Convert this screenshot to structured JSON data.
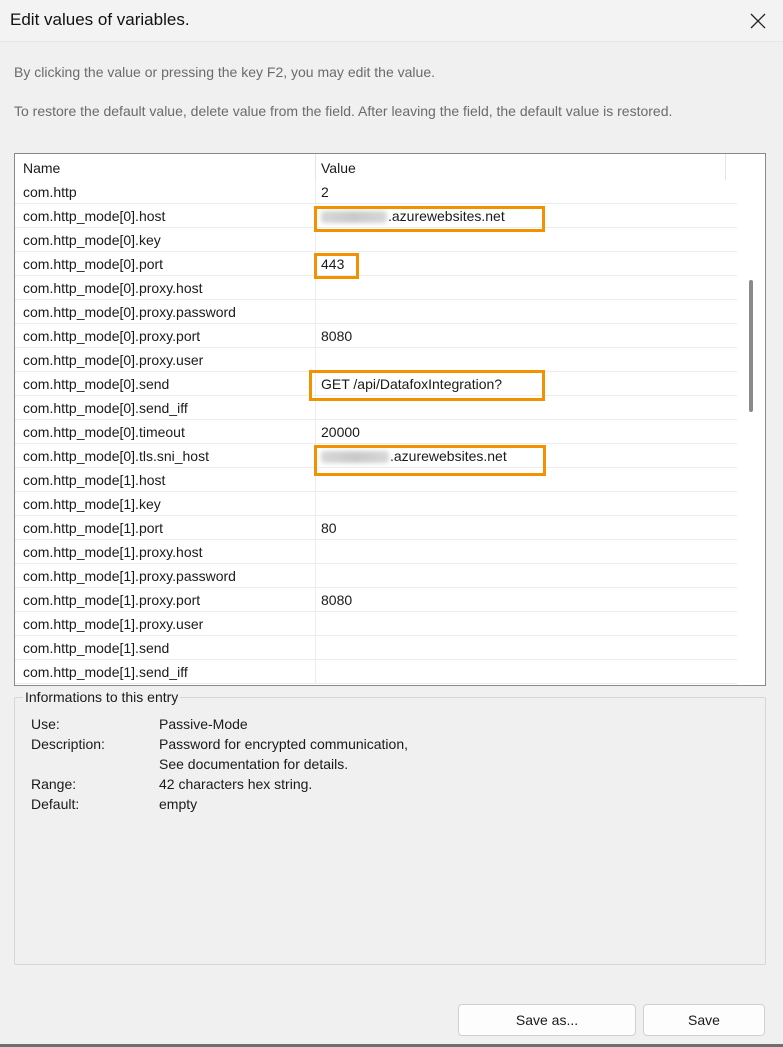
{
  "window": {
    "title": "Edit values of variables.",
    "close_icon": "close-icon"
  },
  "hints": {
    "line1": "By clicking the value or pressing the key F2, you may edit the value.",
    "line2": "To restore the default value, delete value from the field. After leaving the field, the default value is restored."
  },
  "grid": {
    "headers": {
      "name": "Name",
      "value": "Value"
    },
    "rows": [
      {
        "name": "com.http",
        "value": "2"
      },
      {
        "name": "com.http_mode[0].host",
        "value": ".azurewebsites.net"
      },
      {
        "name": "com.http_mode[0].key",
        "value": ""
      },
      {
        "name": "com.http_mode[0].port",
        "value": "443"
      },
      {
        "name": "com.http_mode[0].proxy.host",
        "value": ""
      },
      {
        "name": "com.http_mode[0].proxy.password",
        "value": ""
      },
      {
        "name": "com.http_mode[0].proxy.port",
        "value": "8080"
      },
      {
        "name": "com.http_mode[0].proxy.user",
        "value": ""
      },
      {
        "name": "com.http_mode[0].send",
        "value": "GET /api/DatafoxIntegration?"
      },
      {
        "name": "com.http_mode[0].send_iff",
        "value": ""
      },
      {
        "name": "com.http_mode[0].timeout",
        "value": "20000"
      },
      {
        "name": "com.http_mode[0].tls.sni_host",
        "value": ".azurewebsites.net"
      },
      {
        "name": "com.http_mode[1].host",
        "value": ""
      },
      {
        "name": "com.http_mode[1].key",
        "value": ""
      },
      {
        "name": "com.http_mode[1].port",
        "value": "80"
      },
      {
        "name": "com.http_mode[1].proxy.host",
        "value": ""
      },
      {
        "name": "com.http_mode[1].proxy.password",
        "value": ""
      },
      {
        "name": "com.http_mode[1].proxy.port",
        "value": "8080"
      },
      {
        "name": "com.http_mode[1].proxy.user",
        "value": ""
      },
      {
        "name": "com.http_mode[1].send",
        "value": ""
      },
      {
        "name": "com.http_mode[1].send_iff",
        "value": ""
      }
    ],
    "highlight_color": "#f39200"
  },
  "info": {
    "legend": "Informations to this entry",
    "use_label": "Use:",
    "use_value": "Passive-Mode",
    "description_label": "Description:",
    "description_value_1": "Password for encrypted communication,",
    "description_value_2": "See documentation for details.",
    "range_label": "Range:",
    "range_value": "42 characters hex string.",
    "default_label": "Default:",
    "default_value": "empty"
  },
  "buttons": {
    "save_as": "Save as...",
    "save": "Save"
  }
}
